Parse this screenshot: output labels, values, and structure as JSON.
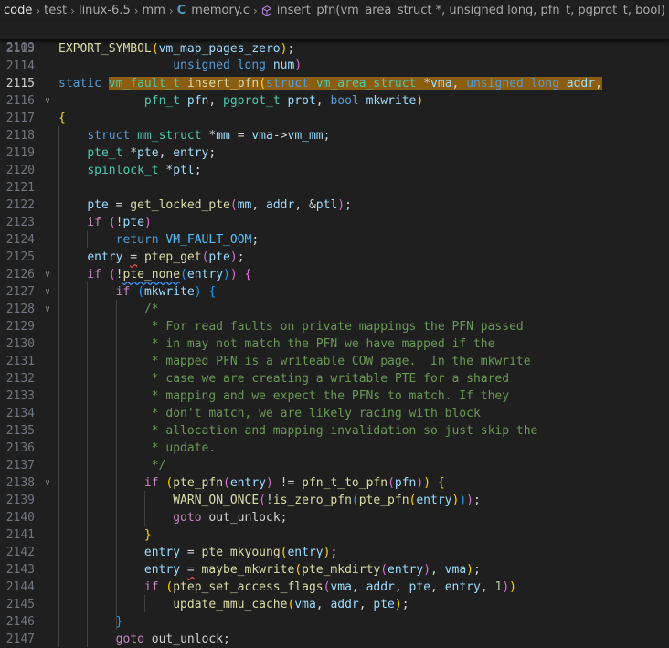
{
  "breadcrumb": {
    "items": [
      "code",
      "test",
      "linux-6.5",
      "mm",
      "memory.c",
      "insert_pfn(vm_area_struct *, unsigned long, pfn_t, pgprot_t, bool)"
    ],
    "c_icon": "C",
    "separator": "›"
  },
  "sticky": [
    {
      "ln": "2109",
      "text": "                unsigned long num)"
    }
  ],
  "lines": [
    {
      "ln": "2113",
      "text": "EXPORT_SYMBOL(vm_map_pages_zero);"
    },
    {
      "ln": "2114",
      "text": ""
    },
    {
      "ln": "2115",
      "text": "static vm_fault_t insert_pfn(struct vm_area_struct *vma, unsigned long addr,"
    },
    {
      "ln": "2116",
      "text": "            pfn_t pfn, pgprot_t prot, bool mkwrite)"
    },
    {
      "ln": "2117",
      "text": "{"
    },
    {
      "ln": "2118",
      "text": "    struct mm_struct *mm = vma->vm_mm;"
    },
    {
      "ln": "2119",
      "text": "    pte_t *pte, entry;"
    },
    {
      "ln": "2120",
      "text": "    spinlock_t *ptl;"
    },
    {
      "ln": "2121",
      "text": ""
    },
    {
      "ln": "2122",
      "text": "    pte = get_locked_pte(mm, addr, &ptl);"
    },
    {
      "ln": "2123",
      "text": "    if (!pte)"
    },
    {
      "ln": "2124",
      "text": "        return VM_FAULT_OOM;"
    },
    {
      "ln": "2125",
      "text": "    entry = ptep_get(pte);"
    },
    {
      "ln": "2126",
      "text": "    if (!pte_none(entry)) {"
    },
    {
      "ln": "2127",
      "text": "        if (mkwrite) {"
    },
    {
      "ln": "2128",
      "text": "            /*"
    },
    {
      "ln": "2129",
      "text": "             * For read faults on private mappings the PFN passed"
    },
    {
      "ln": "2130",
      "text": "             * in may not match the PFN we have mapped if the"
    },
    {
      "ln": "2131",
      "text": "             * mapped PFN is a writeable COW page.  In the mkwrite"
    },
    {
      "ln": "2132",
      "text": "             * case we are creating a writable PTE for a shared"
    },
    {
      "ln": "2133",
      "text": "             * mapping and we expect the PFNs to match. If they"
    },
    {
      "ln": "2134",
      "text": "             * don't match, we are likely racing with block"
    },
    {
      "ln": "2135",
      "text": "             * allocation and mapping invalidation so just skip the"
    },
    {
      "ln": "2136",
      "text": "             * update."
    },
    {
      "ln": "2137",
      "text": "             */"
    },
    {
      "ln": "2138",
      "text": "            if (pte_pfn(entry) != pfn_t_to_pfn(pfn)) {"
    },
    {
      "ln": "2139",
      "text": "                WARN_ON_ONCE(!is_zero_pfn(pte_pfn(entry)));"
    },
    {
      "ln": "2140",
      "text": "                goto out_unlock;"
    },
    {
      "ln": "2141",
      "text": "            }"
    },
    {
      "ln": "2142",
      "text": "            entry = pte_mkyoung(entry);"
    },
    {
      "ln": "2143",
      "text": "            entry = maybe_mkwrite(pte_mkdirty(entry), vma);"
    },
    {
      "ln": "2144",
      "text": "            if (ptep_set_access_flags(vma, addr, pte, entry, 1))"
    },
    {
      "ln": "2145",
      "text": "                update_mmu_cache(vma, addr, pte);"
    },
    {
      "ln": "2146",
      "text": "        }"
    },
    {
      "ln": "2147",
      "text": "        goto out_unlock;"
    }
  ],
  "active_line": "2115",
  "folds": [
    "2116",
    "2126",
    "2127",
    "2128",
    "2138"
  ],
  "colors": {
    "background": "#1f1f1f",
    "keyword": "#569cd6",
    "type": "#4ec9b0",
    "function": "#dcdcaa",
    "variable": "#9cdcfe",
    "comment": "#6a9955",
    "highlight": "#8a5d0f"
  }
}
